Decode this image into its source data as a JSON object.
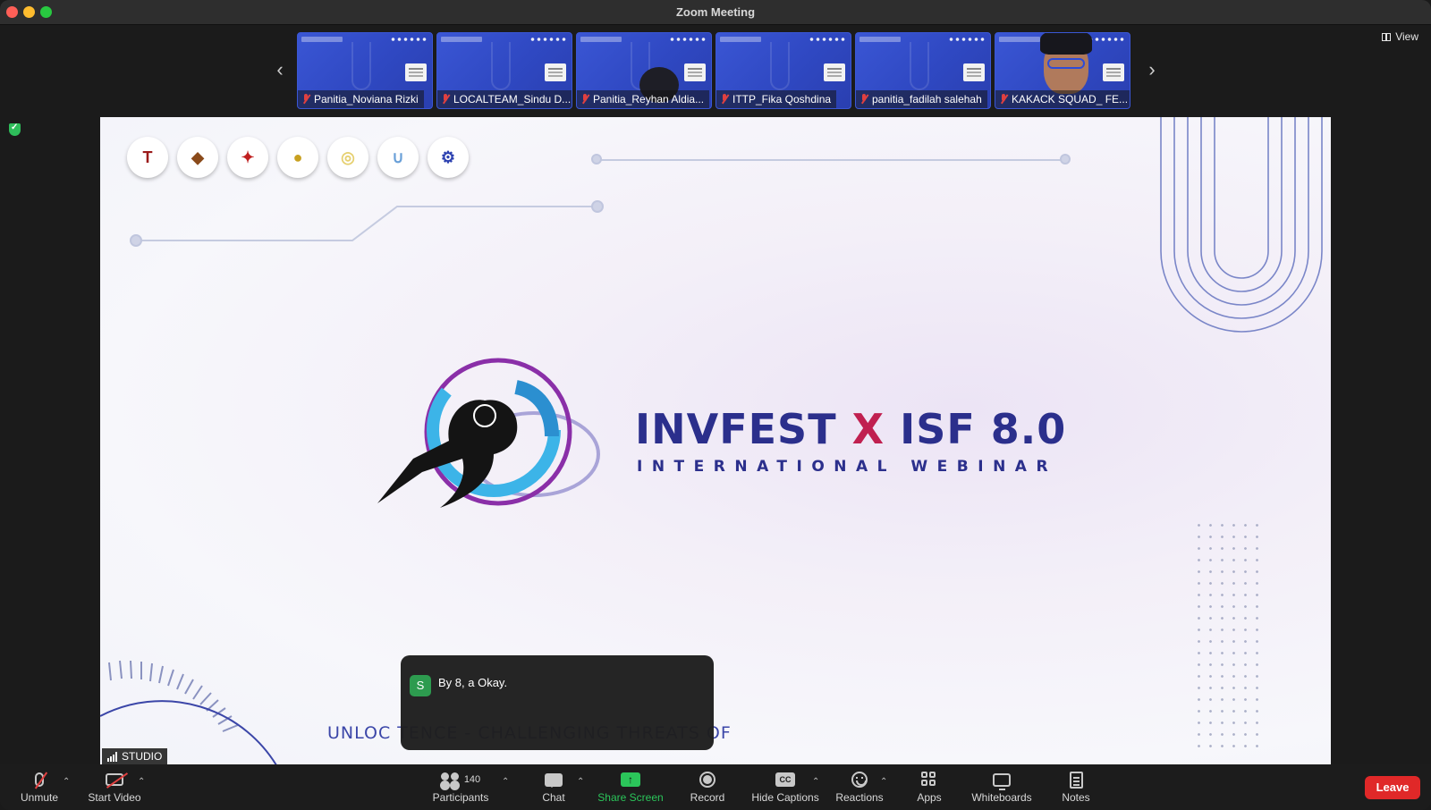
{
  "window": {
    "title": "Zoom Meeting"
  },
  "gallery": {
    "view_label": "View",
    "tiles": [
      {
        "name": "Panitia_Noviana Rizki"
      },
      {
        "name": "LOCALTEAM_Sindu D..."
      },
      {
        "name": "Panitia_Reyhan Aldia..."
      },
      {
        "name": "ITTP_Fika Qoshdina"
      },
      {
        "name": "panitia_fadilah salehah"
      },
      {
        "name": "KAKACK SQUAD_ FE..."
      }
    ]
  },
  "slide": {
    "title_part1": "INVFEST ",
    "title_x": "X",
    "title_part2": " ISF 8.0",
    "subtitle": "INTERNATIONAL WEBINAR",
    "tagline": "UNLOC                                  TENCE - CHALLENGING THREATS OF"
  },
  "caption": {
    "avatar_letter": "S",
    "text": "By 8, a Okay."
  },
  "studio_label": "STUDIO",
  "toolbar": {
    "unmute": "Unmute",
    "start_video": "Start Video",
    "participants": "Participants",
    "participants_count": "140",
    "chat": "Chat",
    "share_screen": "Share Screen",
    "record": "Record",
    "hide_captions": "Hide Captions",
    "reactions": "Reactions",
    "apps": "Apps",
    "whiteboards": "Whiteboards",
    "notes": "Notes",
    "leave": "Leave"
  },
  "colors": {
    "accent_green": "#2bc55a",
    "leave_red": "#e02828",
    "tile_blue": "#3a56d4",
    "slide_title": "#2b2f8c"
  }
}
